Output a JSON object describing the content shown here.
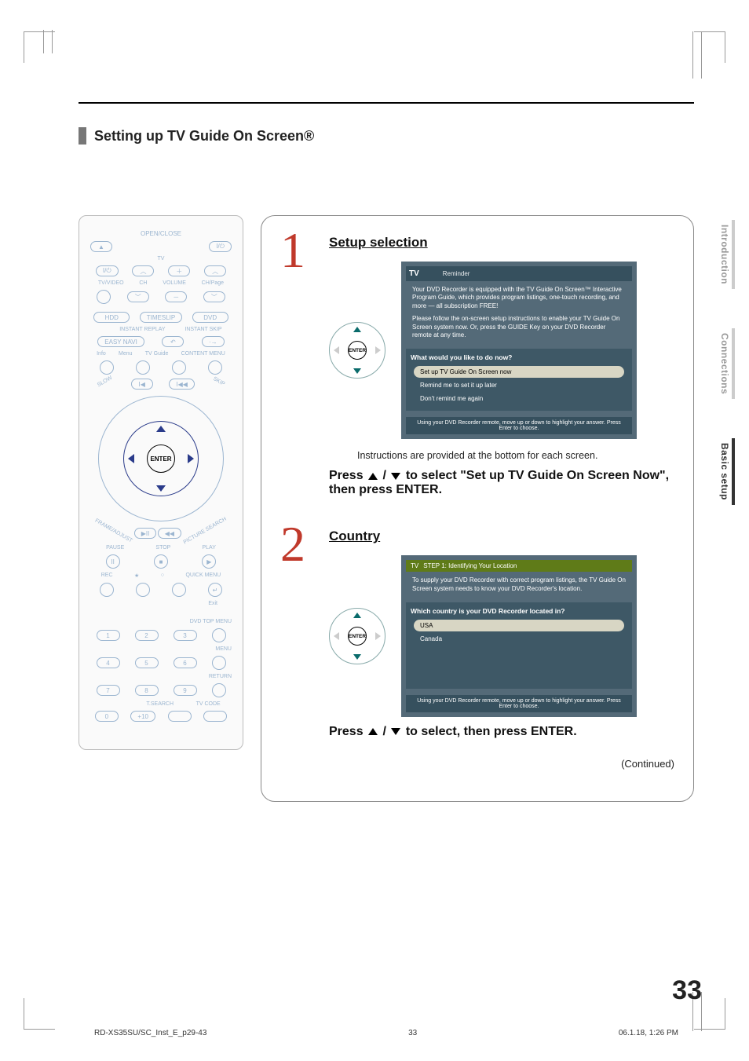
{
  "section_title": "Setting up TV Guide On Screen®",
  "side_tabs": [
    "Introduction",
    "Connections",
    "Basic setup"
  ],
  "active_side_tab": 2,
  "remote": {
    "open_close": "OPEN/CLOSE",
    "tv": "TV",
    "tvvideo": "TV/VIDEO",
    "ch": "CH",
    "volume": "VOLUME",
    "chpage": "CH/Page",
    "hdd": "HDD",
    "timeslip": "TIMESLIP",
    "dvd": "DVD",
    "instant_replay": "INSTANT REPLAY",
    "instant_skip": "INSTANT SKIP",
    "easy_navi": "EASY NAVI",
    "menu": "Menu",
    "tv_guide": "TV Guide",
    "info": "Info",
    "content_menu": "CONTENT MENU",
    "enter": "ENTER",
    "slow": "SLOW",
    "skip": "SKIP",
    "frame_adjust": "FRAME/ADJUST",
    "picture_search": "PICTURE SEARCH",
    "pause": "PAUSE",
    "stop": "STOP",
    "play": "PLAY",
    "rec": "REC",
    "quick_menu": "QUICK MENU",
    "exit": "Exit",
    "dvd_top_menu": "DVD TOP MENU",
    "menu2": "MENU",
    "return": "RETURN",
    "tsearch": "T.SEARCH",
    "tvcode": "TV CODE",
    "plus10": "+10",
    "power_sym": "I/⏻"
  },
  "step1": {
    "number": "1",
    "title": "Setup selection",
    "enter_label": "ENTER",
    "screen": {
      "logo": "TV",
      "tag": "Reminder",
      "para1": "Your DVD Recorder is equipped with the TV Guide On Screen™ Interactive Program Guide, which provides program listings, one-touch recording, and more — all subscription FREE!",
      "para2": "Please follow the on-screen setup instructions to enable your TV Guide On Screen system now. Or, press the GUIDE Key on your DVD Recorder remote at any time.",
      "question": "What would you like to do now?",
      "opt1": "Set up TV Guide On Screen now",
      "opt2": "Remind me to set it up later",
      "opt3": "Don't remind me again",
      "footer": "Using your DVD Recorder remote, move up or down to highlight your answer. Press Enter to choose."
    },
    "instruction": "Instructions are provided at the bottom for each screen.",
    "action_prefix": "Press ",
    "action_suffix": " to select \"Set up TV Guide On Screen Now\", then press ENTER."
  },
  "step2": {
    "number": "2",
    "title": "Country",
    "enter_label": "ENTER",
    "screen": {
      "logo": "TV",
      "step_bar": "STEP 1: Identifying Your Location",
      "para1": "To supply your DVD Recorder with correct program listings, the TV Guide On Screen system needs to know your DVD Recorder's location.",
      "question": "Which country is your DVD Recorder located in?",
      "opt1": "USA",
      "opt2": "Canada",
      "footer": "Using your DVD Recorder remote, move up or down to highlight your answer. Press Enter to choose."
    },
    "action_prefix": "Press ",
    "action_suffix": " to select, then press ENTER."
  },
  "continued": "(Continued)",
  "page_number": "33",
  "footer": {
    "file": "RD-XS35SU/SC_Inst_E_p29-43",
    "pg": "33",
    "timestamp": "06.1.18, 1:26 PM"
  }
}
